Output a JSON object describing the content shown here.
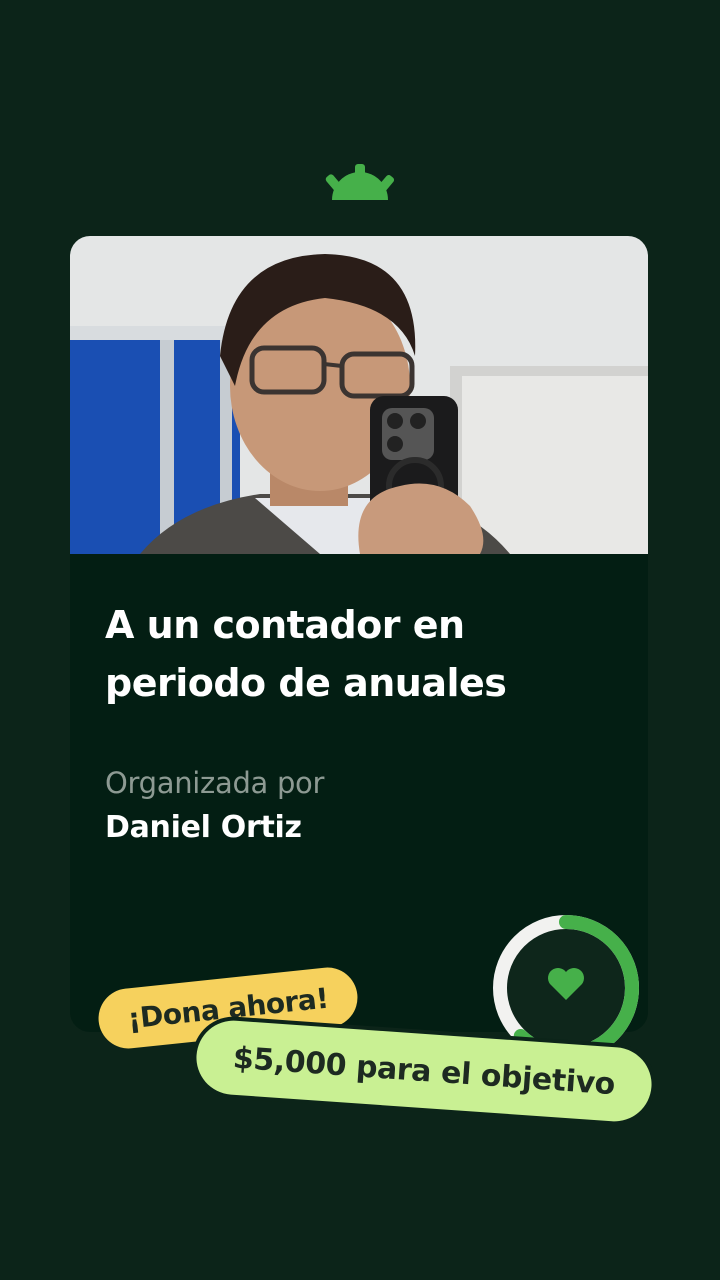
{
  "brand": {
    "logo_icon": "gofundme-logo-icon",
    "color": "#46b04a"
  },
  "campaign": {
    "title": "A un contador en periodo de anuales",
    "organizer_label": "Organizada por",
    "organizer_name": "Daniel Ortiz",
    "photo": "man-mirror-selfie-photo"
  },
  "cta": {
    "label": "¡Dona ahora!",
    "color": "#f6d15d"
  },
  "goal": {
    "label": "$5,000 para el objetivo",
    "color": "#c9f093"
  },
  "progress": {
    "fraction": 0.62,
    "icon": "heart-icon",
    "color": "#46b04a"
  }
}
